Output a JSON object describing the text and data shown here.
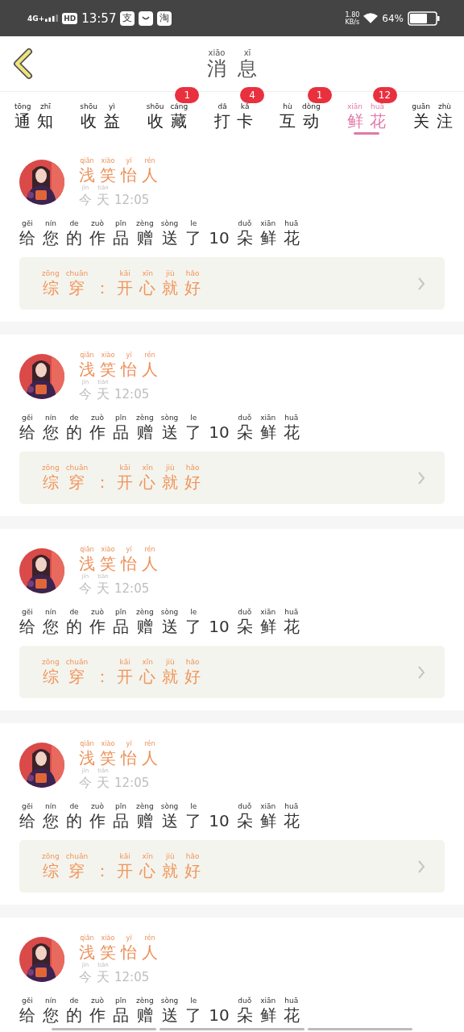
{
  "status_bar": {
    "network": "4G+",
    "hd": "HD",
    "time": "13:57",
    "notifications": [
      {
        "kind": "text",
        "text": "支"
      },
      {
        "kind": "mail"
      },
      {
        "kind": "text",
        "text": "淘"
      }
    ],
    "speed": "1.80",
    "speed_unit": "KB/s",
    "battery": "64%"
  },
  "header": {
    "title": [
      {
        "h": "消",
        "p": "xiāo"
      },
      {
        "h": "息",
        "p": "xī"
      }
    ]
  },
  "tabs": [
    {
      "label": [
        {
          "h": "通",
          "p": "tōng"
        },
        {
          "h": "知",
          "p": "zhī"
        }
      ],
      "selected": false
    },
    {
      "label": [
        {
          "h": "收",
          "p": "shōu"
        },
        {
          "h": "益",
          "p": "yì"
        }
      ],
      "selected": false
    },
    {
      "label": [
        {
          "h": "收",
          "p": "shōu"
        },
        {
          "h": "藏",
          "p": "cáng"
        }
      ],
      "badge": "1",
      "selected": false
    },
    {
      "label": [
        {
          "h": "打",
          "p": "dǎ"
        },
        {
          "h": "卡",
          "p": "kǎ"
        }
      ],
      "badge": "4",
      "selected": false
    },
    {
      "label": [
        {
          "h": "互",
          "p": "hù"
        },
        {
          "h": "动",
          "p": "dòng"
        }
      ],
      "badge": "1",
      "selected": false
    },
    {
      "label": [
        {
          "h": "鲜",
          "p": "xiān"
        },
        {
          "h": "花",
          "p": "huā"
        }
      ],
      "badge": "12",
      "selected": true
    },
    {
      "label": [
        {
          "h": "关",
          "p": "guān"
        },
        {
          "h": "注",
          "p": "zhù"
        }
      ],
      "selected": false
    }
  ],
  "cards": [
    {
      "name": [
        {
          "h": "浅",
          "p": "qiǎn"
        },
        {
          "h": "笑",
          "p": "xiào"
        },
        {
          "h": "怡",
          "p": "yí"
        },
        {
          "h": "人",
          "p": "rén"
        }
      ],
      "date": [
        {
          "h": "今",
          "p": "jīn"
        },
        {
          "h": "天",
          "p": "tiān"
        }
      ],
      "time": "12:05",
      "message": [
        {
          "h": "给",
          "p": "gěi"
        },
        {
          "h": "您",
          "p": "nín"
        },
        {
          "h": "的",
          "p": "de"
        },
        {
          "h": "作",
          "p": "zuò"
        },
        {
          "h": "品",
          "p": "pǐn"
        },
        {
          "h": "赠",
          "p": "zèng"
        },
        {
          "h": "送",
          "p": "sòng"
        },
        {
          "h": "了",
          "p": "le"
        },
        {
          "h": "10"
        },
        {
          "h": "朵",
          "p": "duǒ"
        },
        {
          "h": "鲜",
          "p": "xiān"
        },
        {
          "h": "花",
          "p": "huā"
        }
      ],
      "link": [
        {
          "h": "综",
          "p": "zōng"
        },
        {
          "h": "穿",
          "p": "chuān"
        },
        {
          "h": "："
        },
        {
          "h": "开",
          "p": "kāi"
        },
        {
          "h": "心",
          "p": "xīn"
        },
        {
          "h": "就",
          "p": "jiù"
        },
        {
          "h": "好",
          "p": "hǎo"
        }
      ]
    },
    {
      "name": [
        {
          "h": "浅",
          "p": "qiǎn"
        },
        {
          "h": "笑",
          "p": "xiào"
        },
        {
          "h": "怡",
          "p": "yí"
        },
        {
          "h": "人",
          "p": "rén"
        }
      ],
      "date": [
        {
          "h": "今",
          "p": "jīn"
        },
        {
          "h": "天",
          "p": "tiān"
        }
      ],
      "time": "12:05",
      "message": [
        {
          "h": "给",
          "p": "gěi"
        },
        {
          "h": "您",
          "p": "nín"
        },
        {
          "h": "的",
          "p": "de"
        },
        {
          "h": "作",
          "p": "zuò"
        },
        {
          "h": "品",
          "p": "pǐn"
        },
        {
          "h": "赠",
          "p": "zèng"
        },
        {
          "h": "送",
          "p": "sòng"
        },
        {
          "h": "了",
          "p": "le"
        },
        {
          "h": "10"
        },
        {
          "h": "朵",
          "p": "duǒ"
        },
        {
          "h": "鲜",
          "p": "xiān"
        },
        {
          "h": "花",
          "p": "huā"
        }
      ],
      "link": [
        {
          "h": "综",
          "p": "zōng"
        },
        {
          "h": "穿",
          "p": "chuān"
        },
        {
          "h": "："
        },
        {
          "h": "开",
          "p": "kāi"
        },
        {
          "h": "心",
          "p": "xīn"
        },
        {
          "h": "就",
          "p": "jiù"
        },
        {
          "h": "好",
          "p": "hǎo"
        }
      ]
    },
    {
      "name": [
        {
          "h": "浅",
          "p": "qiǎn"
        },
        {
          "h": "笑",
          "p": "xiào"
        },
        {
          "h": "怡",
          "p": "yí"
        },
        {
          "h": "人",
          "p": "rén"
        }
      ],
      "date": [
        {
          "h": "今",
          "p": "jīn"
        },
        {
          "h": "天",
          "p": "tiān"
        }
      ],
      "time": "12:05",
      "message": [
        {
          "h": "给",
          "p": "gěi"
        },
        {
          "h": "您",
          "p": "nín"
        },
        {
          "h": "的",
          "p": "de"
        },
        {
          "h": "作",
          "p": "zuò"
        },
        {
          "h": "品",
          "p": "pǐn"
        },
        {
          "h": "赠",
          "p": "zèng"
        },
        {
          "h": "送",
          "p": "sòng"
        },
        {
          "h": "了",
          "p": "le"
        },
        {
          "h": "10"
        },
        {
          "h": "朵",
          "p": "duǒ"
        },
        {
          "h": "鲜",
          "p": "xiān"
        },
        {
          "h": "花",
          "p": "huā"
        }
      ],
      "link": [
        {
          "h": "综",
          "p": "zōng"
        },
        {
          "h": "穿",
          "p": "chuān"
        },
        {
          "h": "："
        },
        {
          "h": "开",
          "p": "kāi"
        },
        {
          "h": "心",
          "p": "xīn"
        },
        {
          "h": "就",
          "p": "jiù"
        },
        {
          "h": "好",
          "p": "hǎo"
        }
      ]
    },
    {
      "name": [
        {
          "h": "浅",
          "p": "qiǎn"
        },
        {
          "h": "笑",
          "p": "xiào"
        },
        {
          "h": "怡",
          "p": "yí"
        },
        {
          "h": "人",
          "p": "rén"
        }
      ],
      "date": [
        {
          "h": "今",
          "p": "jīn"
        },
        {
          "h": "天",
          "p": "tiān"
        }
      ],
      "time": "12:05",
      "message": [
        {
          "h": "给",
          "p": "gěi"
        },
        {
          "h": "您",
          "p": "nín"
        },
        {
          "h": "的",
          "p": "de"
        },
        {
          "h": "作",
          "p": "zuò"
        },
        {
          "h": "品",
          "p": "pǐn"
        },
        {
          "h": "赠",
          "p": "zèng"
        },
        {
          "h": "送",
          "p": "sòng"
        },
        {
          "h": "了",
          "p": "le"
        },
        {
          "h": "10"
        },
        {
          "h": "朵",
          "p": "duǒ"
        },
        {
          "h": "鲜",
          "p": "xiān"
        },
        {
          "h": "花",
          "p": "huā"
        }
      ],
      "link": [
        {
          "h": "综",
          "p": "zōng"
        },
        {
          "h": "穿",
          "p": "chuān"
        },
        {
          "h": "："
        },
        {
          "h": "开",
          "p": "kāi"
        },
        {
          "h": "心",
          "p": "xīn"
        },
        {
          "h": "就",
          "p": "jiù"
        },
        {
          "h": "好",
          "p": "hǎo"
        }
      ]
    },
    {
      "name": [
        {
          "h": "浅",
          "p": "qiǎn"
        },
        {
          "h": "笑",
          "p": "xiào"
        },
        {
          "h": "怡",
          "p": "yí"
        },
        {
          "h": "人",
          "p": "rén"
        }
      ],
      "date": [
        {
          "h": "今",
          "p": "jīn"
        },
        {
          "h": "天",
          "p": "tiān"
        }
      ],
      "time": "12:05",
      "message": [
        {
          "h": "给",
          "p": "gěi"
        },
        {
          "h": "您",
          "p": "nín"
        },
        {
          "h": "的",
          "p": "de"
        },
        {
          "h": "作",
          "p": "zuò"
        },
        {
          "h": "品",
          "p": "pǐn"
        },
        {
          "h": "赠",
          "p": "zèng"
        },
        {
          "h": "送",
          "p": "sòng"
        },
        {
          "h": "了",
          "p": "le"
        },
        {
          "h": "10"
        },
        {
          "h": "朵",
          "p": "duǒ"
        },
        {
          "h": "鲜",
          "p": "xiān"
        },
        {
          "h": "花",
          "p": "huā"
        }
      ]
    }
  ]
}
